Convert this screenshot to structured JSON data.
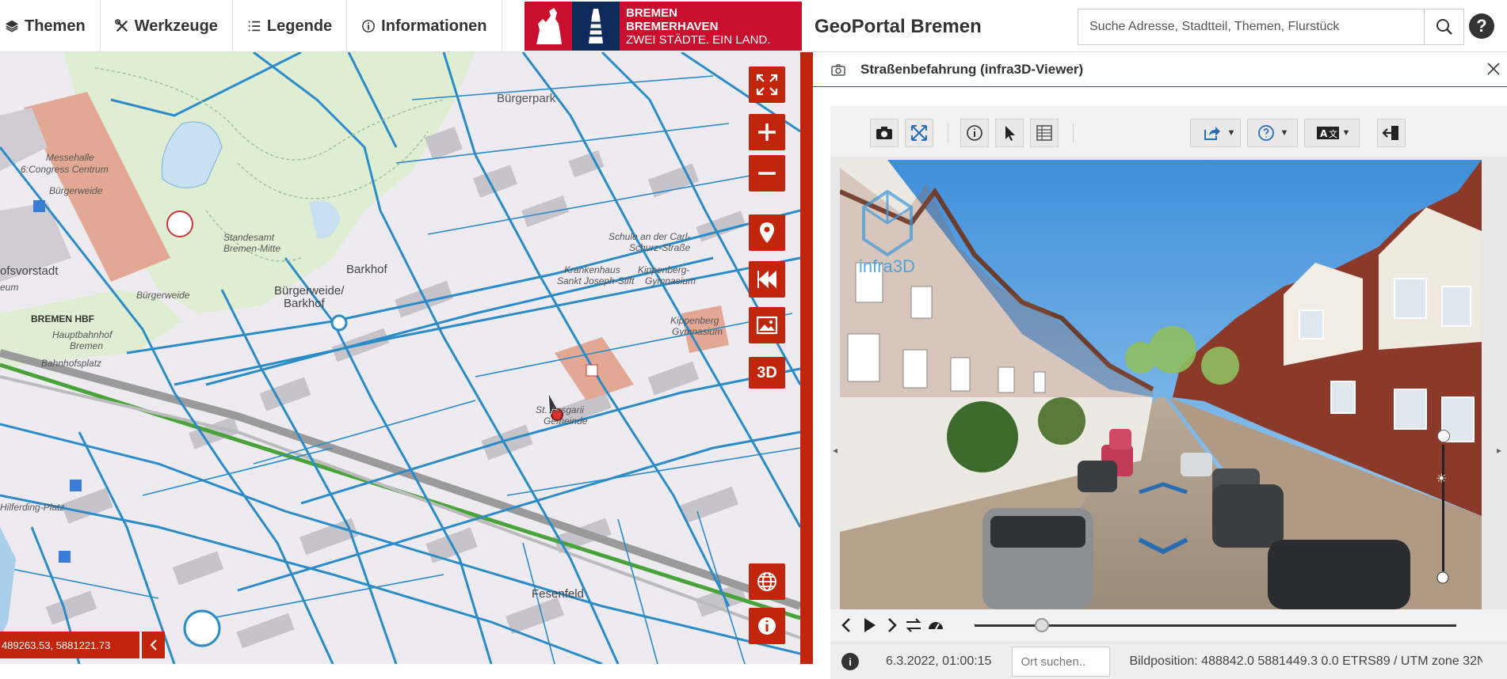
{
  "menu": {
    "themes": "Themen",
    "tools": "Werkzeuge",
    "legend": "Legende",
    "info": "Informationen"
  },
  "logo": {
    "line1": "BREMEN",
    "line2": "BREMERHAVEN",
    "line3": "ZWEI STÄDTE. EIN LAND."
  },
  "header": {
    "title": "GeoPortal Bremen",
    "search_placeholder": "Suche Adresse, Stadtteil, Themen, Flurstück",
    "help": "?"
  },
  "map": {
    "labels": {
      "buergerpark": "Bürgerpark",
      "messehalle": "Messehalle",
      "congress": "6:Congress Centrum",
      "buergerweide": "Bürgerweide",
      "standesamt": "Standesamt",
      "standesamt2": "Bremen-Mitte",
      "buergerweide2": "Bürgerweide",
      "barkhof": "Barkhof",
      "buergerweide_barkhof": "Bürgerweide/",
      "barkhof2": "Barkhof",
      "ofsvorstadt": "ofsvorstadt",
      "eum": "eum",
      "bremen_hbf": "BREMEN HBF",
      "hauptbahnhof": "Hauptbahnhof",
      "hauptbahnhof2": "Bremen",
      "bahnhofsplatz": "Bahnhofsplatz",
      "hilferding": "Hilferding-Platz",
      "schule": "Schule an der Carl-",
      "schule2": "Schurz-Straße",
      "krankenhaus": "Krankenhaus",
      "sanktjoseph": "Sankt Joseph-Stift",
      "kippenberg": "Kippenberg-",
      "gymnasium": "Gymnasium",
      "kippenberg2": "Kippenberg",
      "gymnasium2": "Gymnasium",
      "ansgarii": "St. Ansgarii",
      "gemeinde": "Gemeinde",
      "fesenfeld": "Fesenfeld"
    },
    "control_3d": "3D",
    "coordinates": "489263.53, 5881221.73"
  },
  "panel": {
    "title": "Straßenbefahrung (infra3D-Viewer)",
    "watermark": "infra3D",
    "date": "6.3.2022, 01:00:15",
    "place_placeholder": "Ort suchen..",
    "position": "Bildposition: 488842.0 5881449.3 0.0 ETRS89 / UTM zone 32N",
    "info": "i"
  },
  "playback": {
    "progress": 0.14
  },
  "brightness": {
    "level": 0.63
  },
  "colors": {
    "accent": "#c1260d",
    "map_bg": "#eeebf0",
    "roads_blue": "#2a8bc7",
    "rail_green": "#4aa33a"
  }
}
